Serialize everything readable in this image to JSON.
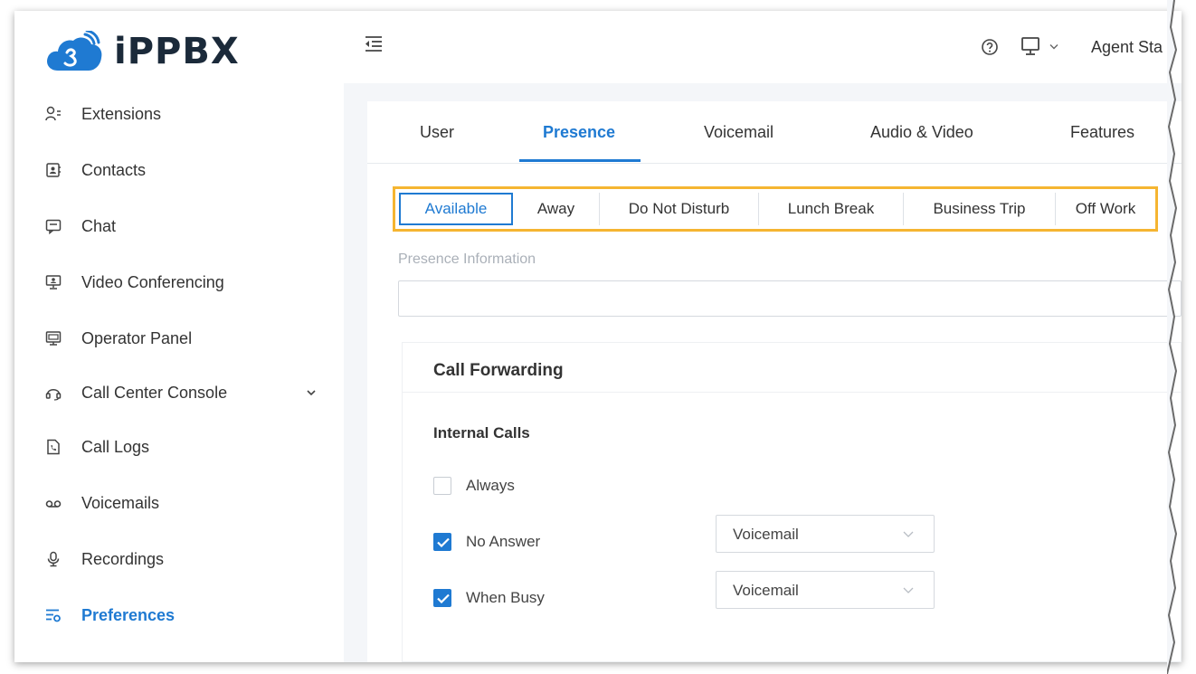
{
  "app": {
    "brand": "iPPBX",
    "accent": "#1f7ad2",
    "highlight": "#f5b531"
  },
  "sidebar": {
    "items": [
      {
        "label": "Extensions",
        "icon": "user-list-icon"
      },
      {
        "label": "Contacts",
        "icon": "contact-book-icon"
      },
      {
        "label": "Chat",
        "icon": "chat-icon"
      },
      {
        "label": "Video Conferencing",
        "icon": "video-conference-icon"
      },
      {
        "label": "Operator Panel",
        "icon": "operator-panel-icon"
      },
      {
        "label": "Call Center Console",
        "icon": "headset-icon"
      },
      {
        "label": "Call Logs",
        "icon": "call-log-icon"
      },
      {
        "label": "Voicemails",
        "icon": "voicemail-icon"
      },
      {
        "label": "Recordings",
        "icon": "microphone-icon"
      },
      {
        "label": "Preferences",
        "icon": "preferences-icon"
      }
    ],
    "active": "Preferences"
  },
  "header": {
    "agent_status": "Agent Sta"
  },
  "tabs": [
    {
      "label": "User"
    },
    {
      "label": "Presence"
    },
    {
      "label": "Voicemail"
    },
    {
      "label": "Audio & Video"
    },
    {
      "label": "Features"
    }
  ],
  "active_tab": "Presence",
  "presence_states": [
    {
      "label": "Available"
    },
    {
      "label": "Away"
    },
    {
      "label": "Do Not Disturb"
    },
    {
      "label": "Lunch Break"
    },
    {
      "label": "Business Trip"
    },
    {
      "label": "Off Work"
    }
  ],
  "active_state": "Available",
  "presence_info": {
    "label": "Presence Information",
    "value": "",
    "placeholder": ""
  },
  "call_forwarding": {
    "title": "Call Forwarding",
    "internal_calls": {
      "title": "Internal Calls",
      "options": [
        {
          "label": "Always",
          "checked": false
        },
        {
          "label": "No Answer",
          "checked": true,
          "destination": "Voicemail"
        },
        {
          "label": "When Busy",
          "checked": true,
          "destination": "Voicemail"
        }
      ]
    }
  }
}
